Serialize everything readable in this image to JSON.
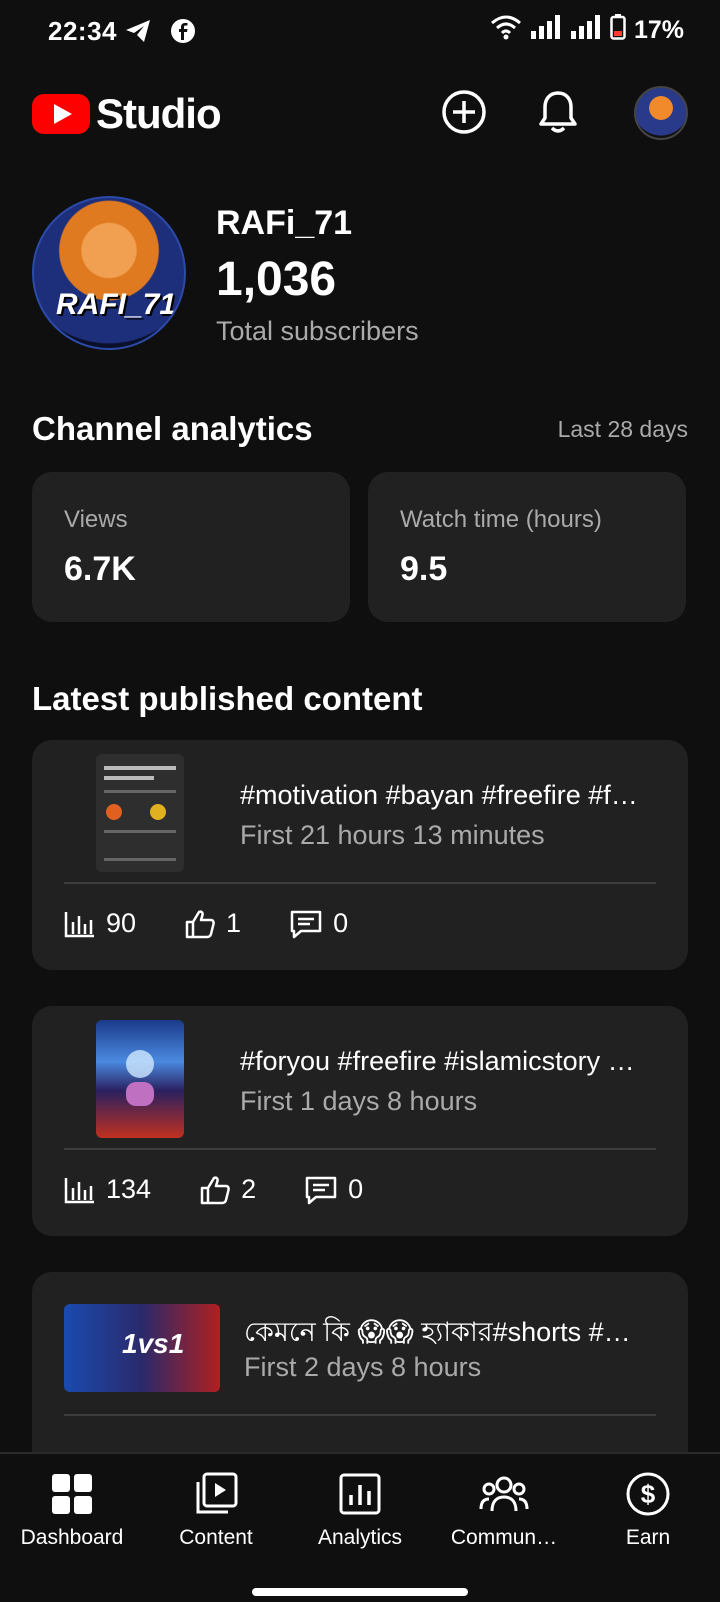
{
  "status_bar": {
    "time": "22:34",
    "battery": "17%",
    "icons": [
      "telegram-icon",
      "facebook-icon",
      "wifi-icon",
      "signal-icon",
      "battery-icon"
    ]
  },
  "header": {
    "app_name": "Studio",
    "icons": [
      "create-icon",
      "bell-icon",
      "avatar"
    ]
  },
  "channel": {
    "name": "RAFi_71",
    "subscribers": "1,036",
    "subscribers_label": "Total subscribers",
    "avatar_text": "RAFI_71"
  },
  "analytics": {
    "title": "Channel analytics",
    "range": "Last 28 days",
    "cards": [
      {
        "label": "Views",
        "value": "6.7K"
      },
      {
        "label": "Watch time (hours)",
        "value": "9.5"
      }
    ]
  },
  "latest": {
    "title": "Latest published content",
    "items": [
      {
        "title": "#motivation #bayan #freefire #f…",
        "sub": "First 21 hours 13 minutes",
        "views": "90",
        "likes": "1",
        "comments": "0"
      },
      {
        "title": "#foryou #freefire #islamicstory …",
        "sub": "First 1 days 8 hours",
        "views": "134",
        "likes": "2",
        "comments": "0"
      },
      {
        "title": "কেমনে কি 😱😱 হ্যাকার#shorts #…",
        "sub": "First 2 days 8 hours",
        "views": "",
        "likes": "",
        "comments": ""
      }
    ]
  },
  "bottom_nav": [
    {
      "label": "Dashboard",
      "icon": "dashboard-icon",
      "active": true
    },
    {
      "label": "Content",
      "icon": "content-icon"
    },
    {
      "label": "Analytics",
      "icon": "analytics-icon"
    },
    {
      "label": "Commun…",
      "icon": "community-icon"
    },
    {
      "label": "Earn",
      "icon": "earn-icon"
    }
  ],
  "colors": {
    "background": "#0f0f0f",
    "card": "#212121",
    "accent": "#ff0000",
    "muted": "#aaaaaa"
  }
}
